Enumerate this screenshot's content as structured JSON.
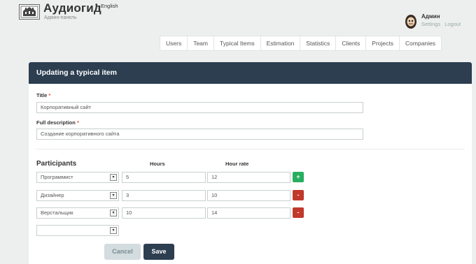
{
  "header": {
    "brand": "Аудиогид",
    "brand_mark": "•",
    "language": "English",
    "subtitle": "Админ-панель"
  },
  "user": {
    "name": "Админ",
    "settings_label": "Settings",
    "logout_label": "Logout"
  },
  "nav": [
    "Users",
    "Team",
    "Typical Items",
    "Estimation",
    "Statistics",
    "Clients",
    "Projects",
    "Companies"
  ],
  "form": {
    "heading": "Updating a typical item",
    "title_label": "Title",
    "title_value": "Корпоративный сайт",
    "description_label": "Full description",
    "description_value": "Создание корпоративного сайта",
    "required_mark": "*",
    "participants_title": "Participants",
    "hours_title": "Hours",
    "rate_title": "Hour rate",
    "participants": [
      {
        "role": "Программист",
        "hours": "5",
        "rate": "12",
        "action": "+"
      },
      {
        "role": "Дизайнер",
        "hours": "3",
        "rate": "10",
        "action": "-"
      },
      {
        "role": "Верстальщик",
        "hours": "10",
        "rate": "14",
        "action": "-"
      }
    ],
    "empty_select": "",
    "select_arrow": "▾",
    "cancel_label": "Cancel",
    "save_label": "Save"
  },
  "colors": {
    "header_bar": "#2c3e50",
    "add_button": "#27ae60",
    "remove_button": "#c0392b",
    "required": "#e74c3c"
  }
}
